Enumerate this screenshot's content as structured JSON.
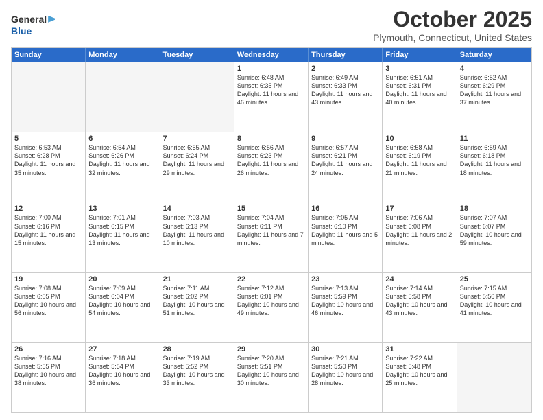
{
  "header": {
    "logo_general": "General",
    "logo_blue": "Blue",
    "month": "October 2025",
    "location": "Plymouth, Connecticut, United States"
  },
  "weekdays": [
    "Sunday",
    "Monday",
    "Tuesday",
    "Wednesday",
    "Thursday",
    "Friday",
    "Saturday"
  ],
  "rows": [
    [
      {
        "day": "",
        "text": "",
        "empty": true
      },
      {
        "day": "",
        "text": "",
        "empty": true
      },
      {
        "day": "",
        "text": "",
        "empty": true
      },
      {
        "day": "1",
        "text": "Sunrise: 6:48 AM\nSunset: 6:35 PM\nDaylight: 11 hours and 46 minutes.",
        "empty": false
      },
      {
        "day": "2",
        "text": "Sunrise: 6:49 AM\nSunset: 6:33 PM\nDaylight: 11 hours and 43 minutes.",
        "empty": false
      },
      {
        "day": "3",
        "text": "Sunrise: 6:51 AM\nSunset: 6:31 PM\nDaylight: 11 hours and 40 minutes.",
        "empty": false
      },
      {
        "day": "4",
        "text": "Sunrise: 6:52 AM\nSunset: 6:29 PM\nDaylight: 11 hours and 37 minutes.",
        "empty": false
      }
    ],
    [
      {
        "day": "5",
        "text": "Sunrise: 6:53 AM\nSunset: 6:28 PM\nDaylight: 11 hours and 35 minutes.",
        "empty": false
      },
      {
        "day": "6",
        "text": "Sunrise: 6:54 AM\nSunset: 6:26 PM\nDaylight: 11 hours and 32 minutes.",
        "empty": false
      },
      {
        "day": "7",
        "text": "Sunrise: 6:55 AM\nSunset: 6:24 PM\nDaylight: 11 hours and 29 minutes.",
        "empty": false
      },
      {
        "day": "8",
        "text": "Sunrise: 6:56 AM\nSunset: 6:23 PM\nDaylight: 11 hours and 26 minutes.",
        "empty": false
      },
      {
        "day": "9",
        "text": "Sunrise: 6:57 AM\nSunset: 6:21 PM\nDaylight: 11 hours and 24 minutes.",
        "empty": false
      },
      {
        "day": "10",
        "text": "Sunrise: 6:58 AM\nSunset: 6:19 PM\nDaylight: 11 hours and 21 minutes.",
        "empty": false
      },
      {
        "day": "11",
        "text": "Sunrise: 6:59 AM\nSunset: 6:18 PM\nDaylight: 11 hours and 18 minutes.",
        "empty": false
      }
    ],
    [
      {
        "day": "12",
        "text": "Sunrise: 7:00 AM\nSunset: 6:16 PM\nDaylight: 11 hours and 15 minutes.",
        "empty": false
      },
      {
        "day": "13",
        "text": "Sunrise: 7:01 AM\nSunset: 6:15 PM\nDaylight: 11 hours and 13 minutes.",
        "empty": false
      },
      {
        "day": "14",
        "text": "Sunrise: 7:03 AM\nSunset: 6:13 PM\nDaylight: 11 hours and 10 minutes.",
        "empty": false
      },
      {
        "day": "15",
        "text": "Sunrise: 7:04 AM\nSunset: 6:11 PM\nDaylight: 11 hours and 7 minutes.",
        "empty": false
      },
      {
        "day": "16",
        "text": "Sunrise: 7:05 AM\nSunset: 6:10 PM\nDaylight: 11 hours and 5 minutes.",
        "empty": false
      },
      {
        "day": "17",
        "text": "Sunrise: 7:06 AM\nSunset: 6:08 PM\nDaylight: 11 hours and 2 minutes.",
        "empty": false
      },
      {
        "day": "18",
        "text": "Sunrise: 7:07 AM\nSunset: 6:07 PM\nDaylight: 10 hours and 59 minutes.",
        "empty": false
      }
    ],
    [
      {
        "day": "19",
        "text": "Sunrise: 7:08 AM\nSunset: 6:05 PM\nDaylight: 10 hours and 56 minutes.",
        "empty": false
      },
      {
        "day": "20",
        "text": "Sunrise: 7:09 AM\nSunset: 6:04 PM\nDaylight: 10 hours and 54 minutes.",
        "empty": false
      },
      {
        "day": "21",
        "text": "Sunrise: 7:11 AM\nSunset: 6:02 PM\nDaylight: 10 hours and 51 minutes.",
        "empty": false
      },
      {
        "day": "22",
        "text": "Sunrise: 7:12 AM\nSunset: 6:01 PM\nDaylight: 10 hours and 49 minutes.",
        "empty": false
      },
      {
        "day": "23",
        "text": "Sunrise: 7:13 AM\nSunset: 5:59 PM\nDaylight: 10 hours and 46 minutes.",
        "empty": false
      },
      {
        "day": "24",
        "text": "Sunrise: 7:14 AM\nSunset: 5:58 PM\nDaylight: 10 hours and 43 minutes.",
        "empty": false
      },
      {
        "day": "25",
        "text": "Sunrise: 7:15 AM\nSunset: 5:56 PM\nDaylight: 10 hours and 41 minutes.",
        "empty": false
      }
    ],
    [
      {
        "day": "26",
        "text": "Sunrise: 7:16 AM\nSunset: 5:55 PM\nDaylight: 10 hours and 38 minutes.",
        "empty": false
      },
      {
        "day": "27",
        "text": "Sunrise: 7:18 AM\nSunset: 5:54 PM\nDaylight: 10 hours and 36 minutes.",
        "empty": false
      },
      {
        "day": "28",
        "text": "Sunrise: 7:19 AM\nSunset: 5:52 PM\nDaylight: 10 hours and 33 minutes.",
        "empty": false
      },
      {
        "day": "29",
        "text": "Sunrise: 7:20 AM\nSunset: 5:51 PM\nDaylight: 10 hours and 30 minutes.",
        "empty": false
      },
      {
        "day": "30",
        "text": "Sunrise: 7:21 AM\nSunset: 5:50 PM\nDaylight: 10 hours and 28 minutes.",
        "empty": false
      },
      {
        "day": "31",
        "text": "Sunrise: 7:22 AM\nSunset: 5:48 PM\nDaylight: 10 hours and 25 minutes.",
        "empty": false
      },
      {
        "day": "",
        "text": "",
        "empty": true
      }
    ]
  ]
}
